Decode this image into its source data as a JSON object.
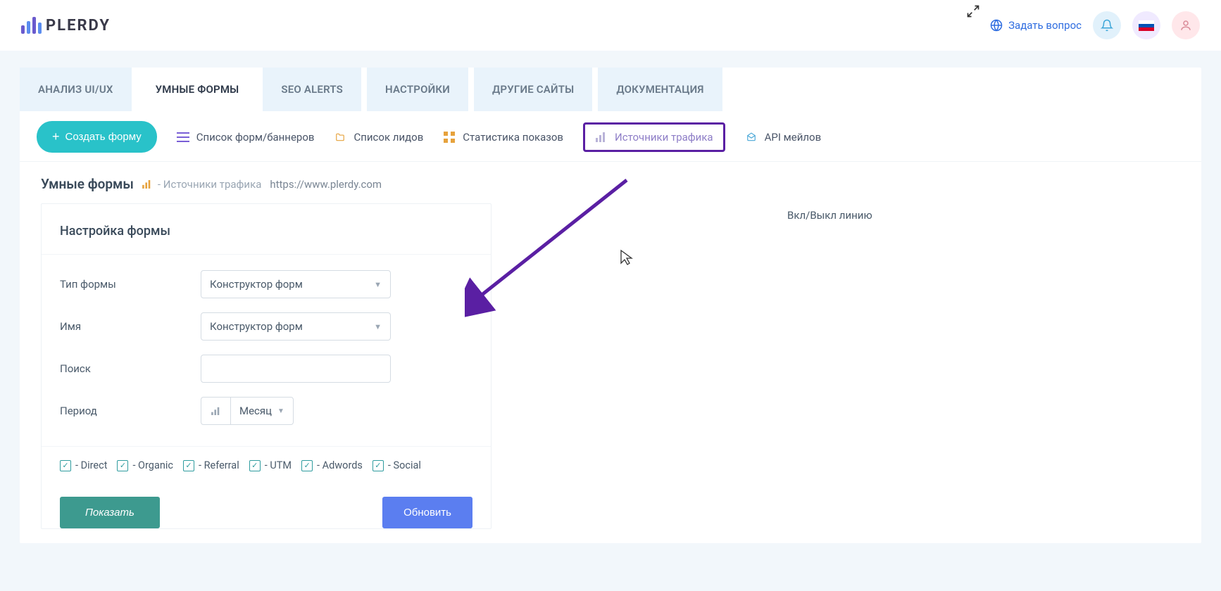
{
  "header": {
    "brand": "PLERDY",
    "ask_question": "Задать вопрос"
  },
  "tabs": [
    {
      "label": "АНАЛИЗ UI/UX",
      "active": false
    },
    {
      "label": "УМНЫЕ ФОРМЫ",
      "active": true
    },
    {
      "label": "SEO ALERTS",
      "active": false
    },
    {
      "label": "НАСТРОЙКИ",
      "active": false
    },
    {
      "label": "ДРУГИЕ САЙТЫ",
      "active": false
    },
    {
      "label": "ДОКУМЕНТАЦИЯ",
      "active": false
    }
  ],
  "subbar": {
    "create_button": "Создать форму",
    "items": [
      {
        "label": "Список форм/баннеров",
        "icon": "list-icon"
      },
      {
        "label": "Список лидов",
        "icon": "folder-icon"
      },
      {
        "label": "Статистика показов",
        "icon": "grid-icon"
      },
      {
        "label": "Источники трафика",
        "icon": "chart-icon",
        "highlighted": true
      },
      {
        "label": "API мейлов",
        "icon": "mail-icon"
      }
    ]
  },
  "breadcrumb": {
    "title": "Умные формы",
    "section": "- Источники трафика",
    "site": "https://www.plerdy.com"
  },
  "form_settings": {
    "heading": "Настройка формы",
    "type_label": "Тип формы",
    "type_value": "Конструктор форм",
    "name_label": "Имя",
    "name_value": "Конструктор форм",
    "search_label": "Поиск",
    "search_value": "",
    "period_label": "Период",
    "period_value": "Месяц",
    "checks": [
      {
        "label": "- Direct",
        "checked": true
      },
      {
        "label": "- Organic",
        "checked": true
      },
      {
        "label": "- Referral",
        "checked": true
      },
      {
        "label": "- UTM",
        "checked": true
      },
      {
        "label": "- Adwords",
        "checked": true
      },
      {
        "label": "- Social",
        "checked": true
      }
    ],
    "show_button": "Показать",
    "update_button": "Обновить"
  },
  "chart_area": {
    "toggle_line": "Вкл/Выкл линию"
  }
}
